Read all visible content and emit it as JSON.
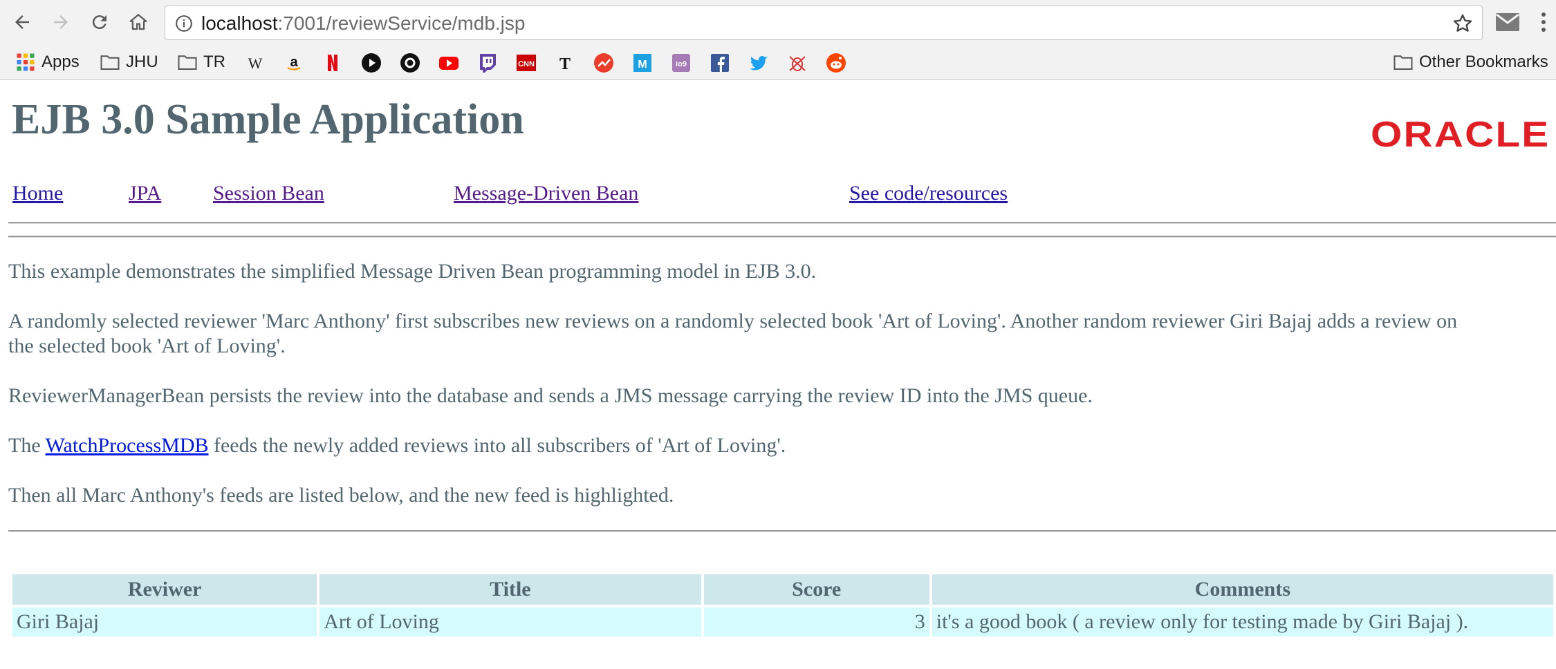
{
  "browser": {
    "url_host": "localhost",
    "url_path": ":7001/reviewService/mdb.jsp",
    "bookmarks": {
      "apps": "Apps",
      "jhu": "JHU",
      "tr": "TR",
      "other": "Other Bookmarks",
      "favicons": [
        "wikipedia-icon",
        "amazon-icon",
        "netflix-icon",
        "play-icon",
        "circle-icon",
        "youtube-icon",
        "twitch-icon",
        "cnn-icon",
        "nytimes-icon",
        "trending-icon",
        "medium-icon",
        "io9-icon",
        "facebook-icon",
        "twitter-icon",
        "bug-icon",
        "reddit-icon"
      ]
    }
  },
  "header": {
    "title": "EJB 3.0 Sample Application",
    "logo": "ORACLE"
  },
  "nav": {
    "home": "Home",
    "jpa": "JPA",
    "session_bean": "Session Bean",
    "mdb": "Message-Driven Bean",
    "code": "See code/resources"
  },
  "content": {
    "p1": "This example demonstrates the simplified Message Driven Bean programming model in EJB 3.0.",
    "p2_line1": "A randomly selected reviewer 'Marc Anthony' first subscribes new reviews on a randomly selected book 'Art of Loving'. Another random reviewer Giri Bajaj adds a review on",
    "p2_line2": "the selected book 'Art of Loving'.",
    "p3": "ReviewerManagerBean persists the review into the database and sends a JMS message carrying the review ID into the JMS queue.",
    "p4_pre": "The ",
    "p4_link": "WatchProcessMDB",
    "p4_post": " feeds the newly added reviews into all subscribers of 'Art of Loving'.",
    "p5": "Then all Marc Anthony's feeds are listed below, and the new feed is highlighted."
  },
  "table": {
    "headers": [
      "Reviwer",
      "Title",
      "Score",
      "Comments"
    ],
    "rows": [
      [
        "Giri Bajaj",
        "Art of Loving",
        "3",
        "it's a good book ( a review only for testing made by Giri Bajaj )."
      ]
    ]
  },
  "colors": {
    "page_text": "#526670",
    "link": "#2418a8",
    "visited_link": "#551a8b",
    "header_cell": "#cde7ea",
    "data_cell": "#d6fbfc",
    "oracle_red": "#e01e24"
  }
}
